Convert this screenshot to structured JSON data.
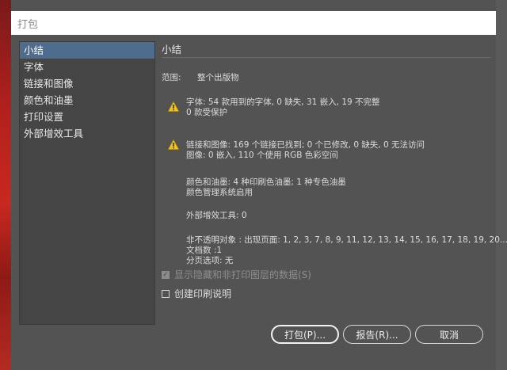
{
  "window": {
    "title": "打包"
  },
  "sidebar": {
    "items": [
      {
        "label": "小结"
      },
      {
        "label": "字体"
      },
      {
        "label": "链接和图像"
      },
      {
        "label": "颜色和油墨"
      },
      {
        "label": "打印设置"
      },
      {
        "label": "外部增效工具"
      }
    ]
  },
  "summary": {
    "title": "小结",
    "scope_label": "范围:",
    "scope_value": "整个出版物",
    "fonts_line1": "字体: 54 款用到的字体, 0 缺失, 31 嵌入, 19 不完整",
    "fonts_line2": "0 款受保护",
    "links_line1": "链接和图像: 169 个链接已找到; 0 个已修改, 0 缺失, 0 无法访问",
    "links_line2": "图像: 0 嵌入, 110 个使用 RGB 色彩空间",
    "colors_line1": "颜色和油墨: 4 种印刷色油墨; 1 种专色油墨",
    "colors_line2": "颜色管理系统启用",
    "plugins_line": "外部增效工具:  0",
    "transparency_line1": "非不透明对象 : 出现页面: 1, 2, 3, 7, 8, 9, 11, 12, 13, 14, 15, 16, 17, 18, 19, 20...",
    "transparency_line2": "文档数 :1",
    "transparency_line3": "分页选项: 无"
  },
  "options": {
    "show_hidden_label": "显示隐藏和非打印图层的数据(S)",
    "show_hidden_checked": true,
    "create_report_label": "创建印刷说明",
    "create_report_checked": false
  },
  "buttons": {
    "package": "打包(P)...",
    "report": "报告(R)...",
    "cancel": "取消"
  },
  "icons": {
    "warning": "warning-icon"
  }
}
